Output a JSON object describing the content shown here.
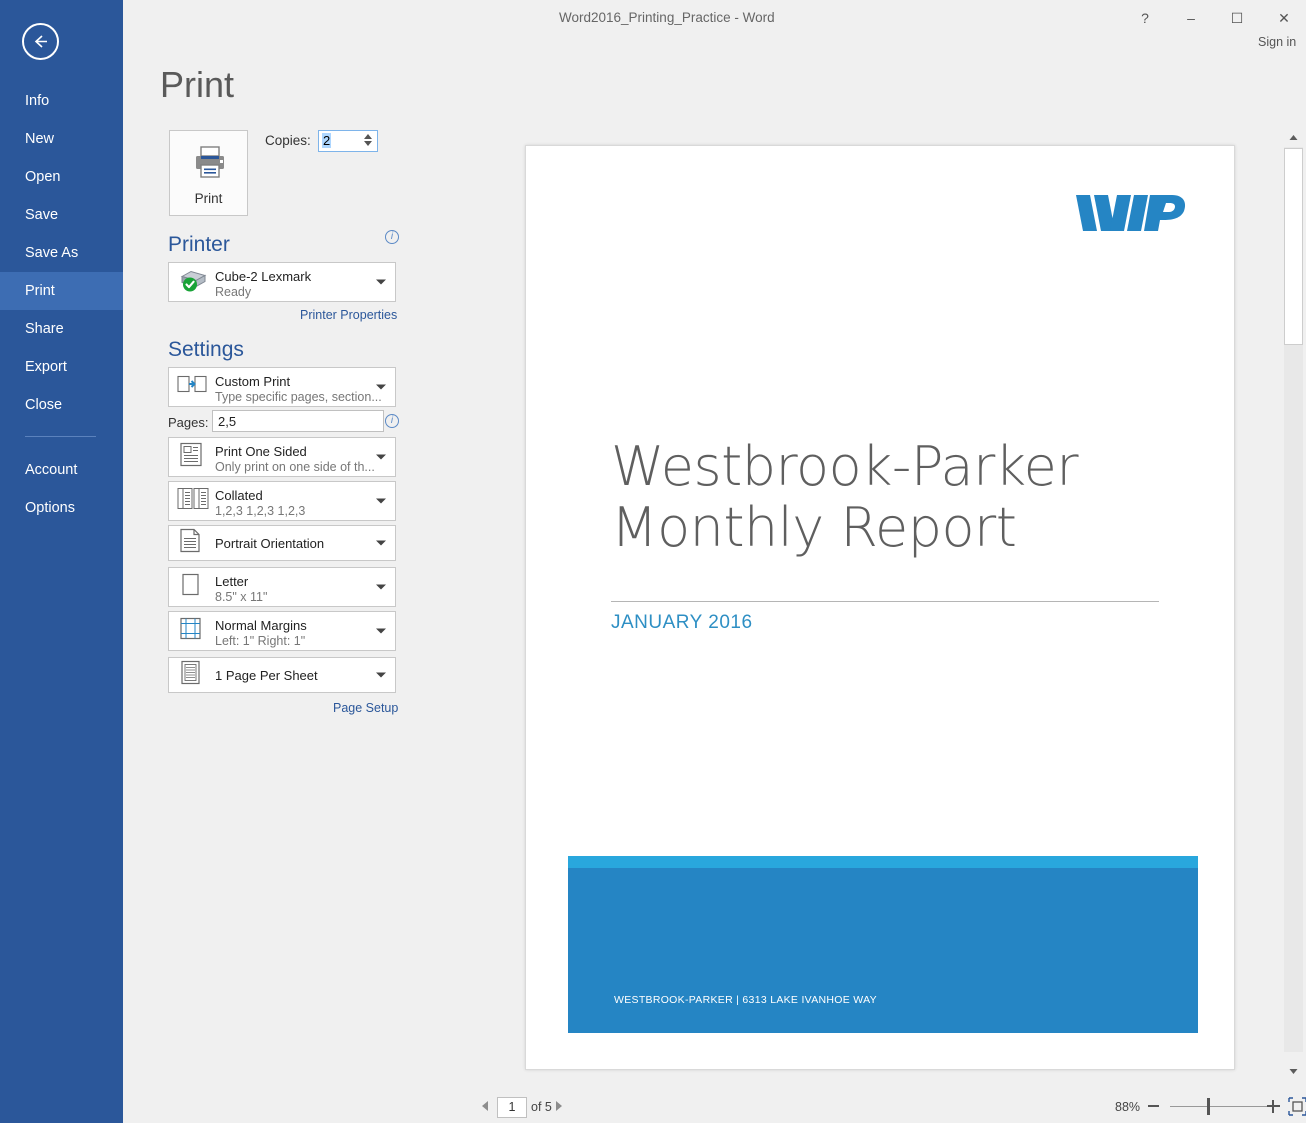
{
  "window": {
    "title": "Word2016_Printing_Practice - Word",
    "sign_in": "Sign in",
    "help_glyph": "?",
    "minimize_glyph": "–",
    "maximize_glyph": "☐",
    "close_glyph": "✕"
  },
  "sidebar": {
    "items": [
      {
        "label": "Info",
        "active": false
      },
      {
        "label": "New",
        "active": false
      },
      {
        "label": "Open",
        "active": false
      },
      {
        "label": "Save",
        "active": false
      },
      {
        "label": "Save As",
        "active": false
      },
      {
        "label": "Print",
        "active": true
      },
      {
        "label": "Share",
        "active": false
      },
      {
        "label": "Export",
        "active": false
      },
      {
        "label": "Close",
        "active": false
      },
      {
        "label": "Account",
        "active": false
      },
      {
        "label": "Options",
        "active": false
      }
    ]
  },
  "page_title": "Print",
  "print_action": {
    "label": "Print",
    "copies_label": "Copies:",
    "copies_value": "2"
  },
  "printer": {
    "heading": "Printer",
    "name": "Cube-2 Lexmark",
    "status": "Ready",
    "properties_link": "Printer Properties"
  },
  "settings": {
    "heading": "Settings",
    "pages_label": "Pages:",
    "pages_value": "2,5",
    "page_setup_link": "Page Setup",
    "rows": [
      {
        "title": "Custom Print",
        "subtitle": "Type specific pages, section..."
      },
      {
        "title": "Print One Sided",
        "subtitle": "Only print on one side of th..."
      },
      {
        "title": "Collated",
        "subtitle": "1,2,3   1,2,3   1,2,3"
      },
      {
        "title": "Portrait Orientation",
        "subtitle": ""
      },
      {
        "title": "Letter",
        "subtitle": "8.5\" x 11\""
      },
      {
        "title": "Normal Margins",
        "subtitle": "Left:  1\"   Right:  1\""
      },
      {
        "title": "1 Page Per Sheet",
        "subtitle": ""
      }
    ]
  },
  "document_preview": {
    "logo_text": "WP",
    "heading": "Westbrook-Parker Monthly Report",
    "subheading": "JANUARY 2016",
    "footer_band": "WESTBROOK-PARKER  |  6313 LAKE IVANHOE WAY"
  },
  "status_bar": {
    "current_page": "1",
    "page_count_label": "of 5",
    "zoom_level": "88%"
  },
  "colors": {
    "office_blue": "#2b579a",
    "rail_active": "#3d6db3",
    "link_blue": "#2b579a",
    "band_blue": "#2585c4",
    "band_accent": "#29a7dd",
    "logo_blue": "#2585c4",
    "sub_blue": "#2e8fc4"
  }
}
